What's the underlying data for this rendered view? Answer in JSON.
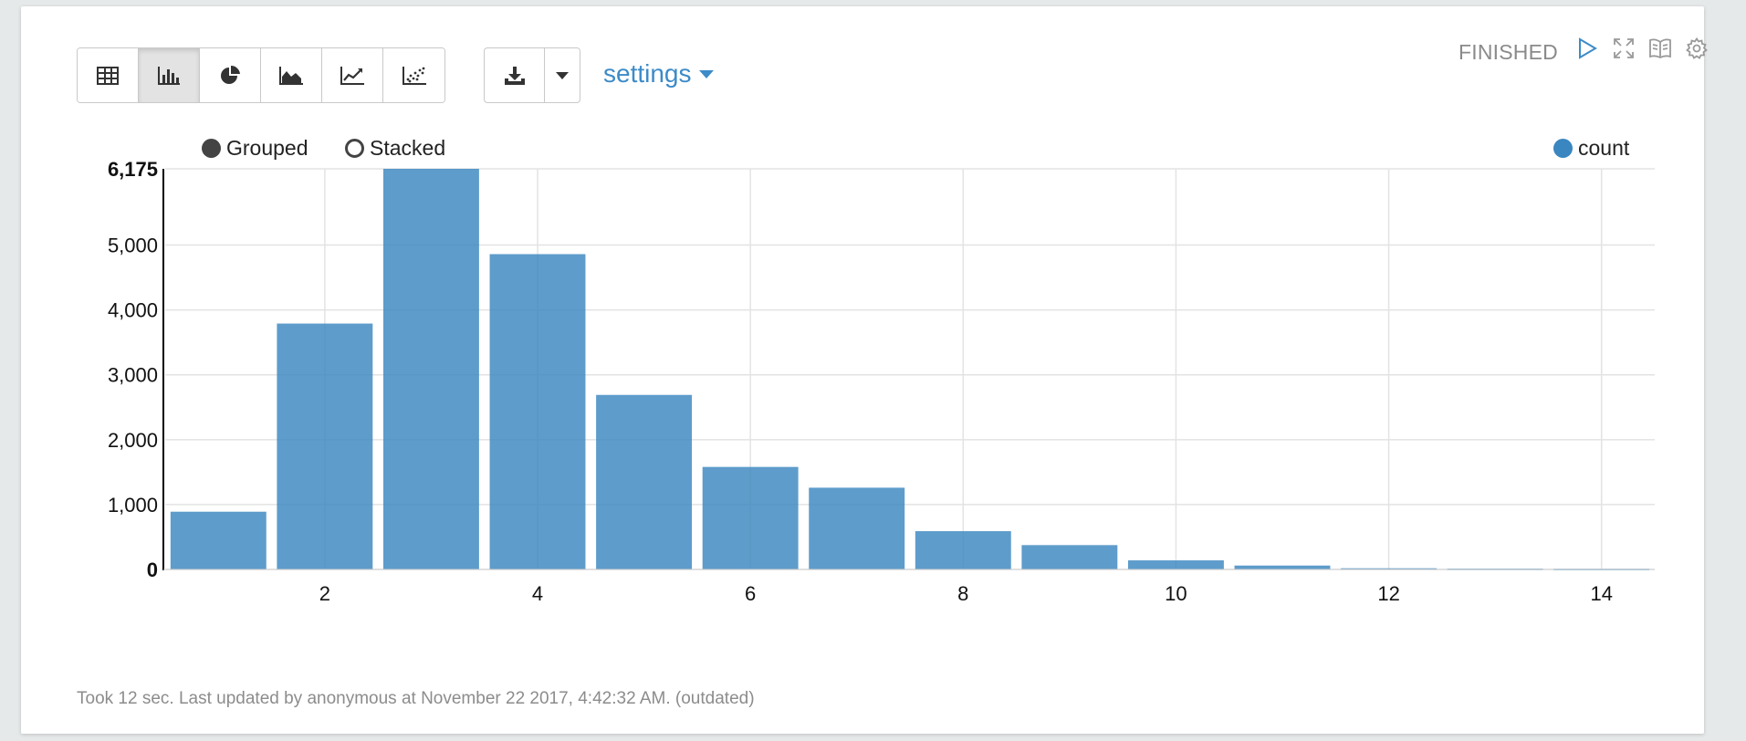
{
  "toolbar": {
    "view_buttons": [
      {
        "name": "table",
        "icon": "table-icon",
        "active": false
      },
      {
        "name": "bar-chart",
        "icon": "bar-chart-icon",
        "active": true
      },
      {
        "name": "pie-chart",
        "icon": "pie-chart-icon",
        "active": false
      },
      {
        "name": "area-chart",
        "icon": "area-chart-icon",
        "active": false
      },
      {
        "name": "line-chart",
        "icon": "line-chart-icon",
        "active": false
      },
      {
        "name": "scatter-chart",
        "icon": "scatter-chart-icon",
        "active": false
      }
    ],
    "download_icon": "download-icon",
    "dropdown_icon": "caret-down-icon",
    "settings_label": "settings"
  },
  "status": {
    "label": "FINISHED",
    "icons": [
      "run-icon",
      "fullscreen-icon",
      "book-icon",
      "gear-icon"
    ]
  },
  "chart_options": {
    "grouped_label": "Grouped",
    "stacked_label": "Stacked",
    "selected": "Grouped"
  },
  "legend": {
    "label": "count",
    "color": "#3a86c0"
  },
  "chart_data": {
    "type": "bar",
    "title": "",
    "xlabel": "",
    "ylabel": "",
    "categories": [
      1,
      2,
      3,
      4,
      5,
      6,
      7,
      8,
      9,
      10,
      11,
      12,
      13,
      14
    ],
    "x_tick_labels": [
      "2",
      "4",
      "6",
      "8",
      "10",
      "12",
      "14"
    ],
    "series": [
      {
        "name": "count",
        "values": [
          890,
          3790,
          6175,
          4860,
          2690,
          1580,
          1260,
          590,
          375,
          140,
          60,
          18,
          12,
          10
        ]
      }
    ],
    "y_tick_labels": [
      "0",
      "1,000",
      "2,000",
      "3,000",
      "4,000",
      "5,000",
      "6,175"
    ],
    "y_ticks": [
      0,
      1000,
      2000,
      3000,
      4000,
      5000,
      6175
    ],
    "ylim": [
      0,
      6175
    ],
    "bar_color": "#3a86c0",
    "grid": true,
    "legend_position": "top-right"
  },
  "footer": {
    "text": "Took 12 sec. Last updated by anonymous at November 22 2017, 4:42:32 AM. (outdated)"
  }
}
